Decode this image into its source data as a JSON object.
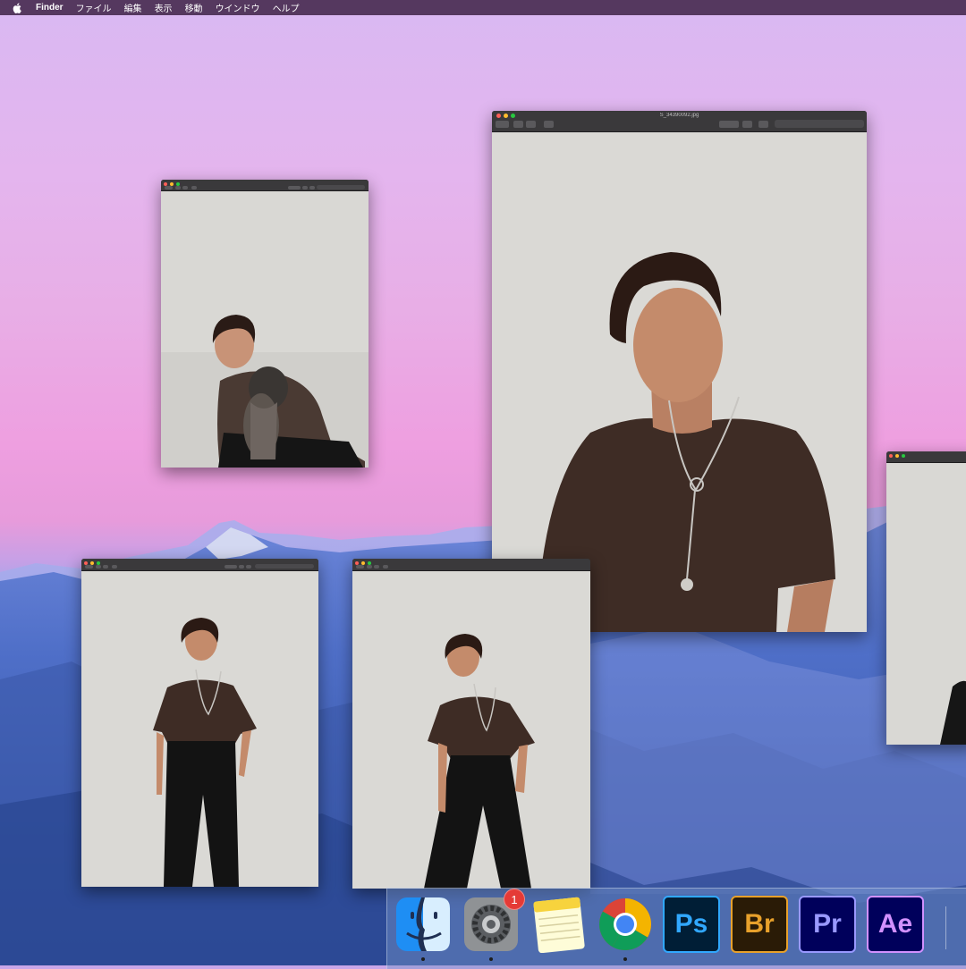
{
  "menubar": {
    "apple_icon": "apple-logo-icon",
    "app_name": "Finder",
    "items": [
      "ファイル",
      "編集",
      "表示",
      "移動",
      "ウインドウ",
      "ヘルプ"
    ]
  },
  "windows": [
    {
      "id": "preview-window-main",
      "title": "S_34390092.jpg"
    }
  ],
  "dock": {
    "apps": [
      {
        "name": "Finder",
        "icon": "finder-icon",
        "running": true
      },
      {
        "name": "System Preferences",
        "icon": "system-preferences-icon",
        "badge": "1",
        "running": true
      },
      {
        "name": "Notes",
        "icon": "notes-icon",
        "running": false
      },
      {
        "name": "Chrome",
        "icon": "chrome-icon",
        "running": true
      },
      {
        "name": "Photoshop",
        "icon": "photoshop-icon",
        "label": "Ps",
        "running": false
      },
      {
        "name": "Bridge",
        "icon": "bridge-icon",
        "label": "Br",
        "running": false
      },
      {
        "name": "Premiere Pro",
        "icon": "premiere-pro-icon",
        "label": "Pr",
        "running": false
      },
      {
        "name": "After Effects",
        "icon": "after-effects-icon",
        "label": "Ae",
        "running": false
      }
    ]
  },
  "colors": {
    "menubar": "#55385f",
    "window_chrome": "#3a393b",
    "photo_wall": "#d8d7d3",
    "ps": "#31a8ff",
    "br": "#e8a12b",
    "pr": "#9999ff",
    "ae": "#d291ff"
  }
}
